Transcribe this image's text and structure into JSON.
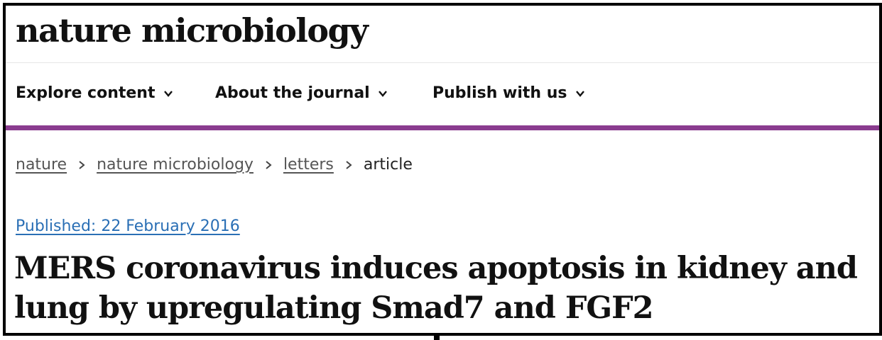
{
  "header": {
    "journal_title": "nature microbiology"
  },
  "nav": {
    "items": [
      {
        "label": "Explore content",
        "icon": "chevron-down-icon"
      },
      {
        "label": "About the journal",
        "icon": "chevron-down-icon"
      },
      {
        "label": "Publish with us",
        "icon": "chevron-down-icon"
      }
    ]
  },
  "colors": {
    "accent_rule": "#8a3c8f",
    "link": "#2a6fb5"
  },
  "breadcrumb": {
    "items": [
      {
        "label": "nature"
      },
      {
        "label": "nature microbiology"
      },
      {
        "label": "letters"
      },
      {
        "label": "article"
      }
    ],
    "separator_icon": "chevron-right-icon"
  },
  "article": {
    "published": "Published: 22 February 2016",
    "title": "MERS coronavirus induces apoptosis in kidney and lung by upregulating Smad7 and FGF2"
  }
}
